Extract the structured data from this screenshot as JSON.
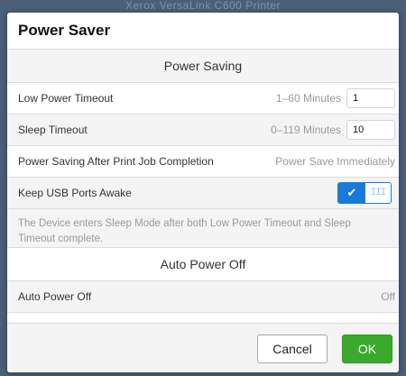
{
  "background": {
    "text": "Xerox VersaLink C600 Printer"
  },
  "dialog": {
    "title": "Power Saver",
    "power_saving": {
      "header": "Power Saving",
      "low_power_timeout": {
        "label": "Low Power Timeout",
        "range": "1–60 Minutes",
        "value": "1"
      },
      "sleep_timeout": {
        "label": "Sleep Timeout",
        "range": "0–119 Minutes",
        "value": "10"
      },
      "after_print": {
        "label": "Power Saving After Print Job Completion",
        "value": "Power Save Immediately"
      },
      "keep_usb": {
        "label": "Keep USB Ports Awake",
        "toggle_on": "✔",
        "toggle_off": "III",
        "enabled": true
      },
      "note": "The Device enters Sleep Mode after both Low Power Timeout and Sleep Timeout complete."
    },
    "auto_power_off": {
      "header": "Auto Power Off",
      "row": {
        "label": "Auto Power Off",
        "value": "Off"
      }
    },
    "buttons": {
      "cancel": "Cancel",
      "ok": "OK"
    }
  },
  "colors": {
    "accent": "#1a7ad9",
    "ok": "#3aaa2c",
    "backdrop": "#4a5f78"
  }
}
